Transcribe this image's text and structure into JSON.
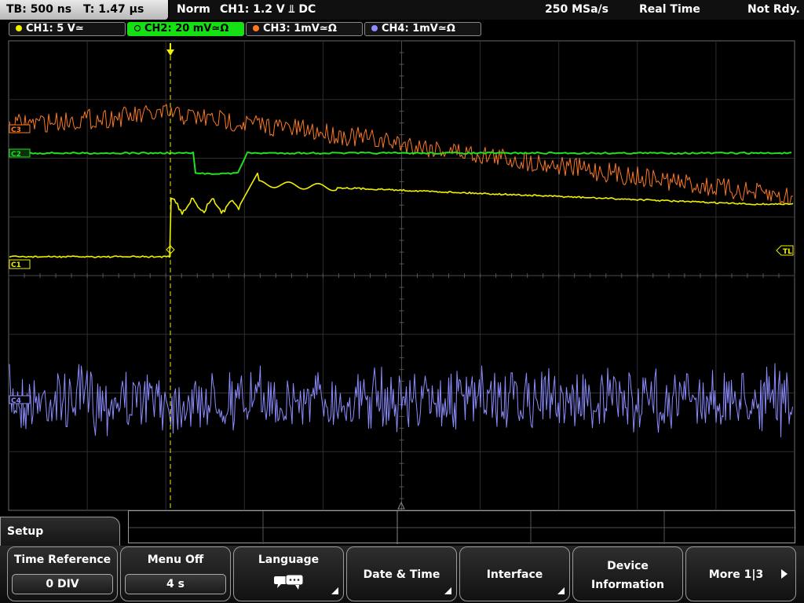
{
  "status": {
    "timebase": "TB: 500 ns",
    "trigger_time": "T: 1.47 µs",
    "mode": "Norm",
    "trigger_info": "CH1: 1.2 V ⫫ DC",
    "sample_rate": "250 MSa/s",
    "acq_mode": "Real Time",
    "ready_state": "Not Rdy."
  },
  "channels": [
    {
      "label": "CH1: 5 V≃",
      "color": "#f0f000"
    },
    {
      "label": "CH2: 20 mV≃Ω",
      "color": "#20e020"
    },
    {
      "label": "CH3: 1mV≃Ω",
      "color": "#ff7a20"
    },
    {
      "label": "CH4: 1mV≃Ω",
      "color": "#8c8cff"
    }
  ],
  "markers": {
    "ch1": "C1",
    "ch2": "C2",
    "ch3": "C3",
    "ch4": "C4",
    "trigger_level": "TL"
  },
  "softkeys": {
    "menu_title": "Setup",
    "time_reference": {
      "label": "Time Reference",
      "value": "0 DIV"
    },
    "menu_off": {
      "label": "Menu Off",
      "value": "4 s"
    },
    "language": {
      "label": "Language",
      "icon": "speech-bubbles-icon"
    },
    "date_time": {
      "label": "Date & Time"
    },
    "interface": {
      "label": "Interface"
    },
    "device_info": {
      "label_line1": "Device",
      "label_line2": "Information"
    },
    "more": {
      "label": "More 1|3"
    }
  }
}
